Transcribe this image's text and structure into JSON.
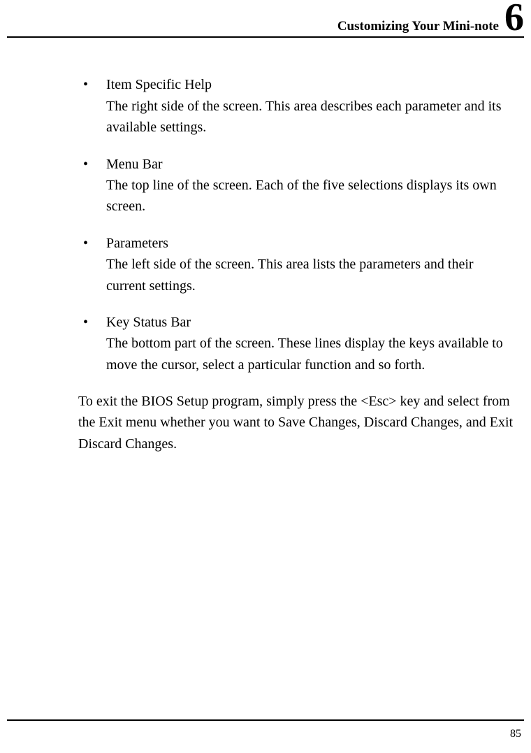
{
  "header": {
    "chapter_title": "Customizing Your Mini-note",
    "chapter_number": "6"
  },
  "items": [
    {
      "title": "Item Specific Help",
      "desc": "The right side of the screen. This area describes each parameter and its available settings."
    },
    {
      "title": "Menu Bar",
      "desc": "The top line of the screen. Each of the five selections displays its own screen."
    },
    {
      "title": "Parameters",
      "desc": "The left side of the screen. This area lists the parameters and their current settings."
    },
    {
      "title": "Key Status Bar",
      "desc": "The bottom part of the screen. These lines display the keys available to move the cursor, select a particular function and so forth."
    }
  ],
  "paragraph": "To exit the BIOS Setup program, simply press the <Esc> key and select from the Exit menu whether you want to Save Changes, Discard Changes, and Exit Discard Changes.",
  "page_number": "85"
}
